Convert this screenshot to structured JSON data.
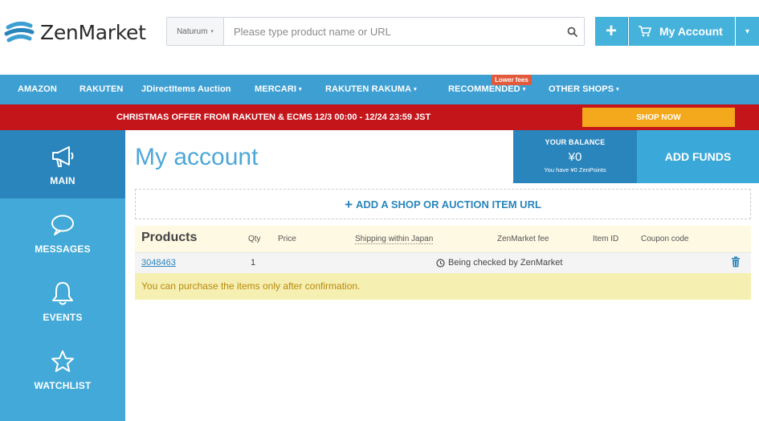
{
  "header": {
    "brand": "ZenMarket",
    "search": {
      "selected_source": "Naturum",
      "placeholder": "Please type product name or URL",
      "value": ""
    },
    "account_label": "My Account"
  },
  "nav": {
    "items": [
      {
        "label": "AMAZON"
      },
      {
        "label": "RAKUTEN"
      },
      {
        "label": "JDirectItems Auction"
      },
      {
        "label": "MERCARI"
      },
      {
        "label": "RAKUTEN RAKUMA"
      },
      {
        "label": "RECOMMENDED"
      },
      {
        "label": "OTHER SHOPS"
      }
    ],
    "badge": "Lower fees"
  },
  "promo": {
    "text": "CHRISTMAS OFFER FROM RAKUTEN & ECMS 12/3 00:00 - 12/24 23:59 JST",
    "button": "SHOP NOW"
  },
  "sidebar": {
    "items": [
      {
        "label": "MAIN",
        "icon": "megaphone-icon"
      },
      {
        "label": "MESSAGES",
        "icon": "speech-bubble-icon"
      },
      {
        "label": "EVENTS",
        "icon": "bell-icon"
      },
      {
        "label": "WATCHLIST",
        "icon": "star-icon"
      }
    ]
  },
  "main": {
    "title": "My account",
    "balance": {
      "label": "YOUR BALANCE",
      "value": "¥0",
      "points": "You have ¥0 ZenPoints"
    },
    "add_funds": "ADD FUNDS",
    "add_url": "ADD A SHOP OR AUCTION ITEM URL",
    "table": {
      "headers": {
        "products": "Products",
        "qty": "Qty",
        "price": "Price",
        "shipping": "Shipping within Japan",
        "fee": "ZenMarket fee",
        "item_id": "Item ID",
        "coupon": "Coupon code"
      },
      "rows": [
        {
          "product": "3048463",
          "qty": "1",
          "status": "Being checked by ZenMarket"
        }
      ]
    },
    "notice": "You can purchase the items only after confirmation."
  },
  "colors": {
    "brand_blue": "#3e9fd3",
    "dark_blue": "#2a85bd",
    "promo_red": "#c4151b",
    "promo_orange": "#f4a81b"
  }
}
